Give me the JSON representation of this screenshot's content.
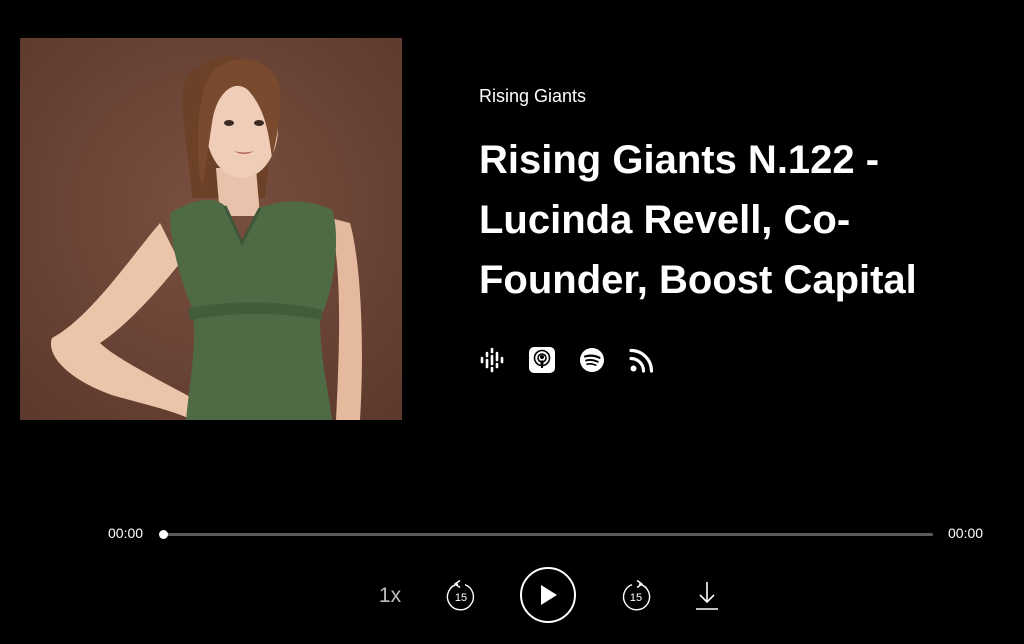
{
  "podcast": {
    "show_name": "Rising Giants",
    "episode_title": "Rising Giants N.122 - Lucinda Revell, Co-Founder, Boost Capital"
  },
  "cover": {
    "icon": "guest-portrait-image"
  },
  "platforms": [
    {
      "icon": "google-podcasts-icon"
    },
    {
      "icon": "apple-podcasts-icon"
    },
    {
      "icon": "spotify-icon"
    },
    {
      "icon": "rss-feed-icon"
    }
  ],
  "player": {
    "current_time": "00:00",
    "total_time": "00:00",
    "progress": 0,
    "speed": "1x",
    "rewind_seconds": "15",
    "forward_seconds": "15"
  },
  "colors": {
    "background": "#000000",
    "text": "#ffffff",
    "track": "#5b5b5b",
    "cover_background": "#6b4536",
    "dress": "#4f6b46"
  }
}
